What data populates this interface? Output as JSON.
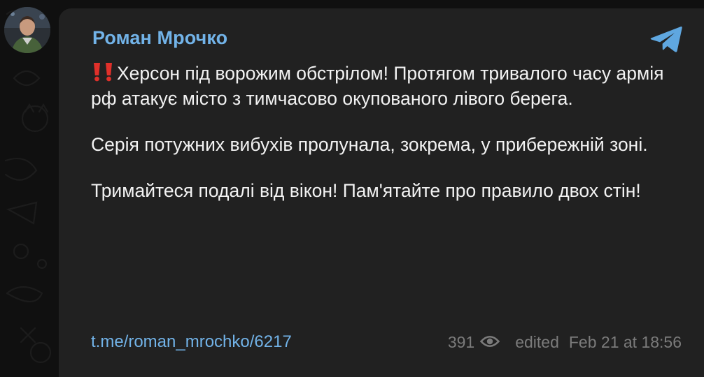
{
  "channel": {
    "name": "Роман Мрочко",
    "avatar_icon": "user-photo-avatar",
    "source_icon": "telegram-icon"
  },
  "message": {
    "alert_icon": "double-exclamation-icon",
    "paragraphs": [
      "Херсон під ворожим обстрілом! Протягом тривалого часу армія рф атакує місто з тимчасово окупованого лівого берега.",
      "Серія потужних вибухів пролунала, зокрема, у прибережній зоні.",
      "Тримайтеся подалі від вікон! Пам'ятайте про правило двох стін!"
    ]
  },
  "footer": {
    "link": "t.me/roman_mrochko/6217",
    "views": "391",
    "edited": "edited",
    "timestamp": "Feb 21 at 18:56"
  },
  "colors": {
    "background": "#101010",
    "bubble": "#212121",
    "accent": "#72b3e8",
    "text": "#f2f2f2",
    "muted": "#7b7b7b",
    "alert": "#e0302a"
  }
}
